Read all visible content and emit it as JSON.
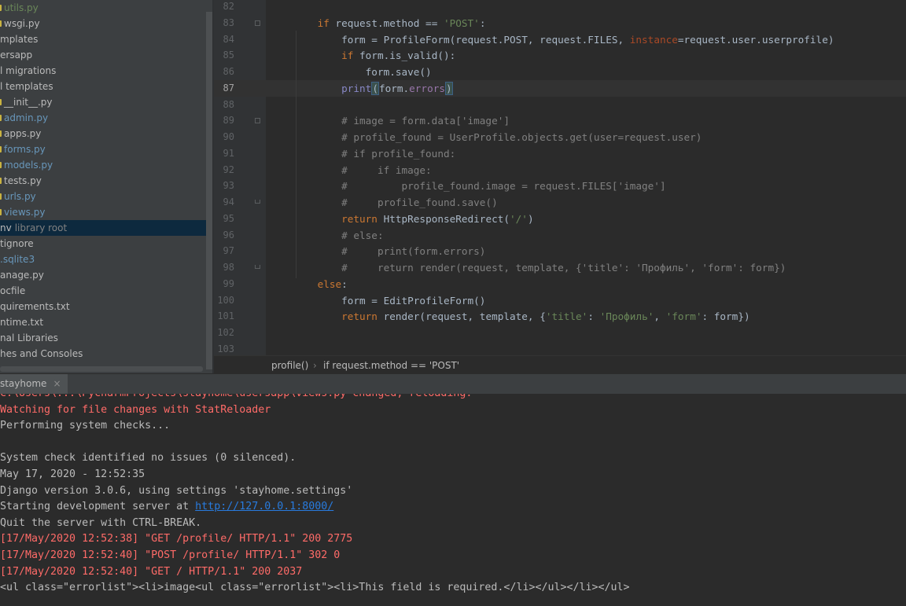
{
  "project_tree": {
    "items": [
      {
        "label": "utils.py",
        "icon": "python-file-icon",
        "color": "#6a8759"
      },
      {
        "label": "wsgi.py",
        "icon": "python-file-icon",
        "color": "#bbbbbb"
      },
      {
        "label": "mplates",
        "icon": "",
        "color": "#bbbbbb"
      },
      {
        "label": "ersapp",
        "icon": "",
        "color": "#bbbbbb"
      },
      {
        "label": "l migrations",
        "icon": "",
        "color": "#bbbbbb"
      },
      {
        "label": "l templates",
        "icon": "",
        "color": "#bbbbbb"
      },
      {
        "label": "__init__.py",
        "icon": "python-file-icon",
        "color": "#bbbbbb"
      },
      {
        "label": "admin.py",
        "icon": "python-file-icon",
        "color": "#6897bb"
      },
      {
        "label": "apps.py",
        "icon": "python-file-icon",
        "color": "#bbbbbb"
      },
      {
        "label": "forms.py",
        "icon": "python-file-icon",
        "color": "#6897bb"
      },
      {
        "label": "models.py",
        "icon": "python-file-icon",
        "color": "#6897bb"
      },
      {
        "label": "tests.py",
        "icon": "python-file-icon",
        "color": "#bbbbbb"
      },
      {
        "label": "urls.py",
        "icon": "python-file-icon",
        "color": "#6897bb"
      },
      {
        "label": "views.py",
        "icon": "python-file-icon",
        "color": "#6897bb"
      },
      {
        "label": "nv",
        "sub": "library root",
        "icon": "",
        "color": "#bbbbbb",
        "selected": true
      },
      {
        "label": "tignore",
        "icon": "",
        "color": "#bbbbbb"
      },
      {
        "label": ".sqlite3",
        "icon": "",
        "color": "#6897bb"
      },
      {
        "label": "anage.py",
        "icon": "",
        "color": "#bbbbbb"
      },
      {
        "label": "ocfile",
        "icon": "",
        "color": "#bbbbbb"
      },
      {
        "label": "quirements.txt",
        "icon": "",
        "color": "#bbbbbb"
      },
      {
        "label": "ntime.txt",
        "icon": "",
        "color": "#bbbbbb"
      },
      {
        "label": "nal Libraries",
        "icon": "",
        "color": "#bbbbbb"
      },
      {
        "label": "hes and Consoles",
        "icon": "",
        "color": "#bbbbbb"
      }
    ],
    "selected_bg": "#0d293e"
  },
  "editor": {
    "current_line": 87,
    "lines": [
      {
        "n": "82",
        "tokens": []
      },
      {
        "n": "83",
        "tokens": [
          [
            "",
            "    "
          ],
          [
            "kw",
            "if "
          ],
          [
            "nm",
            "request.method == "
          ],
          [
            "st",
            "'POST'"
          ],
          [
            "nm",
            ":"
          ]
        ]
      },
      {
        "n": "84",
        "tokens": [
          [
            "",
            "        "
          ],
          [
            "nm",
            "form = ProfileForm(request.POST, request.FILES, "
          ],
          [
            "pr",
            "instance"
          ],
          [
            "nm",
            "=request.user.userprofile)"
          ]
        ]
      },
      {
        "n": "85",
        "tokens": [
          [
            "",
            "        "
          ],
          [
            "kw",
            "if "
          ],
          [
            "nm",
            "form.is_valid():"
          ]
        ]
      },
      {
        "n": "86",
        "tokens": [
          [
            "",
            "            "
          ],
          [
            "nm",
            "form.save()"
          ]
        ]
      },
      {
        "n": "87",
        "tokens": [
          [
            "",
            "        "
          ],
          [
            "fn",
            "print"
          ],
          [
            "mb",
            "("
          ],
          [
            "nm",
            "form."
          ],
          [
            "hl",
            "errors"
          ],
          [
            "mb",
            ")"
          ]
        ]
      },
      {
        "n": "88",
        "tokens": []
      },
      {
        "n": "89",
        "tokens": [
          [
            "",
            "        "
          ],
          [
            "cm",
            "# image = form.data['image']"
          ]
        ]
      },
      {
        "n": "90",
        "tokens": [
          [
            "",
            "        "
          ],
          [
            "cm",
            "# profile_found = UserProfile.objects.get(user=request.user)"
          ]
        ]
      },
      {
        "n": "91",
        "tokens": [
          [
            "",
            "        "
          ],
          [
            "cm",
            "# if profile_found:"
          ]
        ]
      },
      {
        "n": "92",
        "tokens": [
          [
            "",
            "        "
          ],
          [
            "cm",
            "#     if image:"
          ]
        ]
      },
      {
        "n": "93",
        "tokens": [
          [
            "",
            "        "
          ],
          [
            "cm",
            "#         profile_found.image = request.FILES['image']"
          ]
        ]
      },
      {
        "n": "94",
        "tokens": [
          [
            "",
            "        "
          ],
          [
            "cm",
            "#     profile_found.save()"
          ]
        ]
      },
      {
        "n": "95",
        "tokens": [
          [
            "",
            "        "
          ],
          [
            "kw",
            "return "
          ],
          [
            "nm",
            "HttpResponseRedirect("
          ],
          [
            "st",
            "'/'"
          ],
          [
            "nm",
            ")"
          ]
        ]
      },
      {
        "n": "96",
        "tokens": [
          [
            "",
            "        "
          ],
          [
            "cm",
            "# else:"
          ]
        ]
      },
      {
        "n": "97",
        "tokens": [
          [
            "",
            "        "
          ],
          [
            "cm",
            "#     print(form.errors)"
          ]
        ]
      },
      {
        "n": "98",
        "tokens": [
          [
            "",
            "        "
          ],
          [
            "cm",
            "#     return render(request, template, {'title': 'Профиль', 'form': form})"
          ]
        ]
      },
      {
        "n": "99",
        "tokens": [
          [
            "",
            "    "
          ],
          [
            "kw",
            "else"
          ],
          [
            "nm",
            ":"
          ]
        ]
      },
      {
        "n": "100",
        "tokens": [
          [
            "",
            "        "
          ],
          [
            "nm",
            "form = EditProfileForm()"
          ]
        ]
      },
      {
        "n": "101",
        "tokens": [
          [
            "",
            "        "
          ],
          [
            "kw",
            "return "
          ],
          [
            "nm",
            "render(request, template, {"
          ],
          [
            "st",
            "'title'"
          ],
          [
            "nm",
            ": "
          ],
          [
            "st",
            "'Профиль'"
          ],
          [
            "nm",
            ", "
          ],
          [
            "st",
            "'form'"
          ],
          [
            "nm",
            ": form})"
          ]
        ]
      },
      {
        "n": "102",
        "tokens": []
      },
      {
        "n": "103",
        "tokens": []
      }
    ]
  },
  "breadcrumb": {
    "function": "profile()",
    "separator": "›",
    "condition": "if request.method == 'POST'"
  },
  "run_panel": {
    "tab_label": "stayhome",
    "close_label": "×",
    "lines": [
      {
        "text": "C:\\Users\\...\\PycharmProjects\\stayhome\\usersapp\\views.py changed, reloading.",
        "style": "err"
      },
      {
        "text": "Watching for file changes with StatReloader",
        "style": "err"
      },
      {
        "text": "Performing system checks...",
        "style": ""
      },
      {
        "text": "",
        "style": ""
      },
      {
        "text": "System check identified no issues (0 silenced).",
        "style": ""
      },
      {
        "text": "May 17, 2020 - 12:52:35",
        "style": ""
      },
      {
        "text": "Django version 3.0.6, using settings 'stayhome.settings'",
        "style": ""
      },
      {
        "text": "Starting development server at ",
        "link": "http://127.0.0.1:8000/",
        "style": ""
      },
      {
        "text": "Quit the server with CTRL-BREAK.",
        "style": ""
      },
      {
        "text": "[17/May/2020 12:52:38] \"GET /profile/ HTTP/1.1\" 200 2775",
        "style": "err"
      },
      {
        "text": "[17/May/2020 12:52:40] \"POST /profile/ HTTP/1.1\" 302 0",
        "style": "err"
      },
      {
        "text": "[17/May/2020 12:52:40] \"GET / HTTP/1.1\" 200 2037",
        "style": "err"
      },
      {
        "text": "<ul class=\"errorlist\"><li>image<ul class=\"errorlist\"><li>This field is required.</li></ul></li></ul>",
        "style": ""
      }
    ]
  }
}
